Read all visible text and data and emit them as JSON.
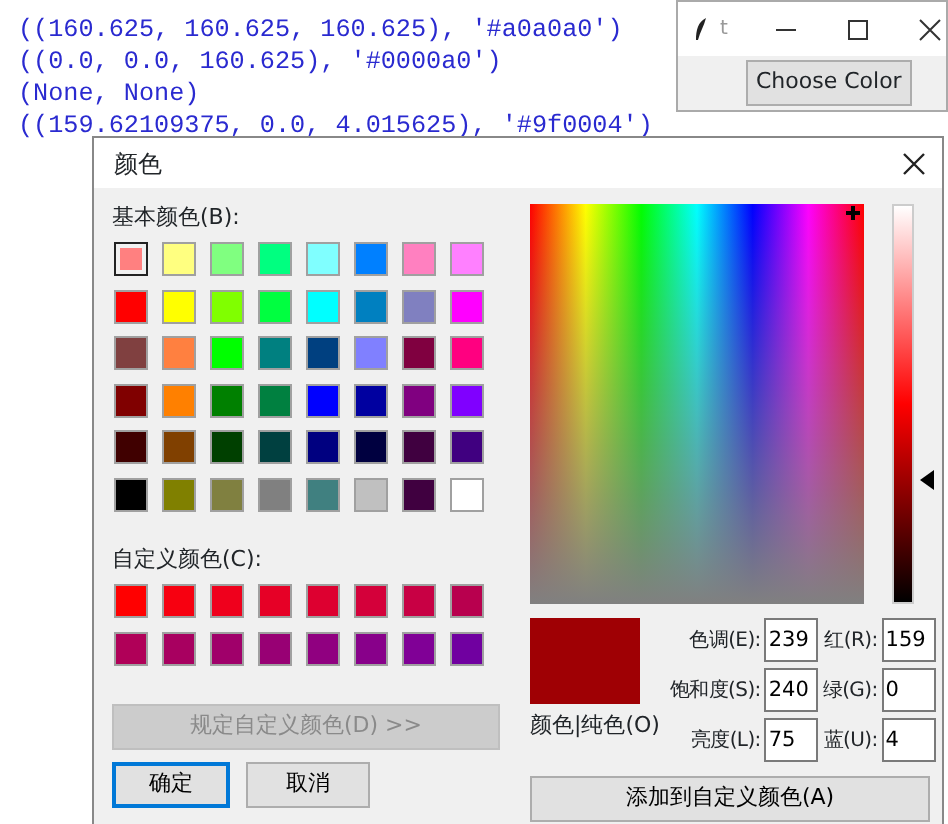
{
  "console": {
    "lines": [
      "((160.625, 160.625, 160.625), '#a0a0a0')",
      "((0.0, 0.0, 160.625), '#0000a0')",
      "(None, None)",
      "((159.62109375, 0.0, 4.015625), '#9f0004')"
    ]
  },
  "tk_window": {
    "title": "t",
    "button": "Choose Color"
  },
  "dialog": {
    "title": "颜色",
    "basic_label": "基本颜色(B):",
    "basic_colors": [
      {
        "color": "#ff8080",
        "selected": true
      },
      {
        "color": "#ffff80",
        "selected": false
      },
      {
        "color": "#80ff80",
        "selected": false
      },
      {
        "color": "#00ff80",
        "selected": false
      },
      {
        "color": "#80ffff",
        "selected": false
      },
      {
        "color": "#0080ff",
        "selected": false
      },
      {
        "color": "#ff80c0",
        "selected": false
      },
      {
        "color": "#ff80ff",
        "selected": false
      },
      {
        "color": "#ff0000",
        "selected": false
      },
      {
        "color": "#ffff00",
        "selected": false
      },
      {
        "color": "#80ff00",
        "selected": false
      },
      {
        "color": "#00ff40",
        "selected": false
      },
      {
        "color": "#00ffff",
        "selected": false
      },
      {
        "color": "#0080c0",
        "selected": false
      },
      {
        "color": "#8080c0",
        "selected": false
      },
      {
        "color": "#ff00ff",
        "selected": false
      },
      {
        "color": "#804040",
        "selected": false
      },
      {
        "color": "#ff8040",
        "selected": false
      },
      {
        "color": "#00ff00",
        "selected": false
      },
      {
        "color": "#008080",
        "selected": false
      },
      {
        "color": "#004080",
        "selected": false
      },
      {
        "color": "#8080ff",
        "selected": false
      },
      {
        "color": "#800040",
        "selected": false
      },
      {
        "color": "#ff0080",
        "selected": false
      },
      {
        "color": "#800000",
        "selected": false
      },
      {
        "color": "#ff8000",
        "selected": false
      },
      {
        "color": "#008000",
        "selected": false
      },
      {
        "color": "#008040",
        "selected": false
      },
      {
        "color": "#0000ff",
        "selected": false
      },
      {
        "color": "#0000a0",
        "selected": false
      },
      {
        "color": "#800080",
        "selected": false
      },
      {
        "color": "#8000ff",
        "selected": false
      },
      {
        "color": "#400000",
        "selected": false
      },
      {
        "color": "#804000",
        "selected": false
      },
      {
        "color": "#004000",
        "selected": false
      },
      {
        "color": "#004040",
        "selected": false
      },
      {
        "color": "#000080",
        "selected": false
      },
      {
        "color": "#000040",
        "selected": false
      },
      {
        "color": "#400040",
        "selected": false
      },
      {
        "color": "#400080",
        "selected": false
      },
      {
        "color": "#000000",
        "selected": false
      },
      {
        "color": "#808000",
        "selected": false
      },
      {
        "color": "#808040",
        "selected": false
      },
      {
        "color": "#808080",
        "selected": false
      },
      {
        "color": "#408080",
        "selected": false
      },
      {
        "color": "#c0c0c0",
        "selected": false
      },
      {
        "color": "#400040",
        "selected": false
      },
      {
        "color": "#ffffff",
        "selected": false
      }
    ],
    "custom_label": "自定义颜色(C):",
    "custom_colors": [
      {
        "color": "#ff0000"
      },
      {
        "color": "#f70010"
      },
      {
        "color": "#ef001c"
      },
      {
        "color": "#e60026"
      },
      {
        "color": "#dd0030"
      },
      {
        "color": "#d4003a"
      },
      {
        "color": "#c80044"
      },
      {
        "color": "#b8004e"
      },
      {
        "color": "#b00058"
      },
      {
        "color": "#a80060"
      },
      {
        "color": "#a0006a"
      },
      {
        "color": "#980074"
      },
      {
        "color": "#900080"
      },
      {
        "color": "#88008a"
      },
      {
        "color": "#800096"
      },
      {
        "color": "#7000a0"
      }
    ],
    "define_button": {
      "label": "规定自定义颜色(D) >>",
      "disabled": true
    },
    "ok_button": "确定",
    "cancel_button": "取消",
    "luminance": {
      "level": 0.31
    },
    "preview": {
      "color": "#9f0004"
    },
    "preview_label": "颜色|纯色(O)",
    "fields": [
      {
        "label": "色调(E):",
        "value": "239"
      },
      {
        "label": "红(R):",
        "value": "159"
      },
      {
        "label": "饱和度(S):",
        "value": "240"
      },
      {
        "label": "绿(G):",
        "value": "0"
      },
      {
        "label": "亮度(L):",
        "value": "75"
      },
      {
        "label": "蓝(U):",
        "value": "4"
      }
    ],
    "add_button": "添加到自定义颜色(A)"
  }
}
